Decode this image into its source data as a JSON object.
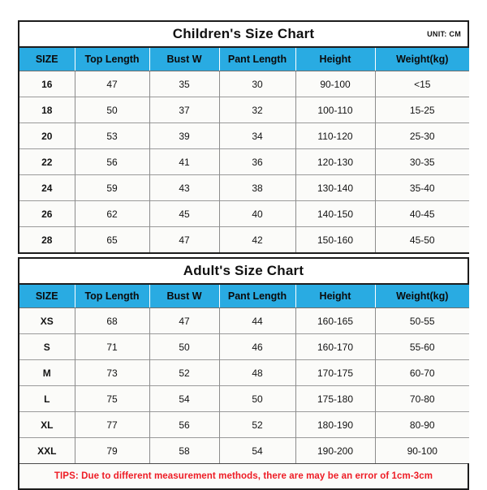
{
  "children": {
    "title": "Children's Size Chart",
    "unit_label": "UNIT: CM",
    "columns": [
      "SIZE",
      "Top Length",
      "Bust W",
      "Pant Length",
      "Height",
      "Weight(kg)"
    ],
    "rows": [
      {
        "size": "16",
        "top_length": "47",
        "bust_w": "35",
        "pant_length": "30",
        "height": "90-100",
        "weight": "<15"
      },
      {
        "size": "18",
        "top_length": "50",
        "bust_w": "37",
        "pant_length": "32",
        "height": "100-110",
        "weight": "15-25"
      },
      {
        "size": "20",
        "top_length": "53",
        "bust_w": "39",
        "pant_length": "34",
        "height": "110-120",
        "weight": "25-30"
      },
      {
        "size": "22",
        "top_length": "56",
        "bust_w": "41",
        "pant_length": "36",
        "height": "120-130",
        "weight": "30-35"
      },
      {
        "size": "24",
        "top_length": "59",
        "bust_w": "43",
        "pant_length": "38",
        "height": "130-140",
        "weight": "35-40"
      },
      {
        "size": "26",
        "top_length": "62",
        "bust_w": "45",
        "pant_length": "40",
        "height": "140-150",
        "weight": "40-45"
      },
      {
        "size": "28",
        "top_length": "65",
        "bust_w": "47",
        "pant_length": "42",
        "height": "150-160",
        "weight": "45-50"
      }
    ]
  },
  "adult": {
    "title": "Adult's Size Chart",
    "columns": [
      "SIZE",
      "Top Length",
      "Bust W",
      "Pant Length",
      "Height",
      "Weight(kg)"
    ],
    "rows": [
      {
        "size": "XS",
        "top_length": "68",
        "bust_w": "47",
        "pant_length": "44",
        "height": "160-165",
        "weight": "50-55"
      },
      {
        "size": "S",
        "top_length": "71",
        "bust_w": "50",
        "pant_length": "46",
        "height": "160-170",
        "weight": "55-60"
      },
      {
        "size": "M",
        "top_length": "73",
        "bust_w": "52",
        "pant_length": "48",
        "height": "170-175",
        "weight": "60-70"
      },
      {
        "size": "L",
        "top_length": "75",
        "bust_w": "54",
        "pant_length": "50",
        "height": "175-180",
        "weight": "70-80"
      },
      {
        "size": "XL",
        "top_length": "77",
        "bust_w": "56",
        "pant_length": "52",
        "height": "180-190",
        "weight": "80-90"
      },
      {
        "size": "XXL",
        "top_length": "79",
        "bust_w": "58",
        "pant_length": "54",
        "height": "190-200",
        "weight": "90-100"
      }
    ],
    "tips": "TIPS: Due to different measurement methods, there are may be an error of 1cm-3cm"
  },
  "colors": {
    "header_blue": "#29ABE2",
    "tips_red": "#ee1c25",
    "border_dark": "#1c1c1c",
    "cell_background": "#fbfbf9"
  }
}
